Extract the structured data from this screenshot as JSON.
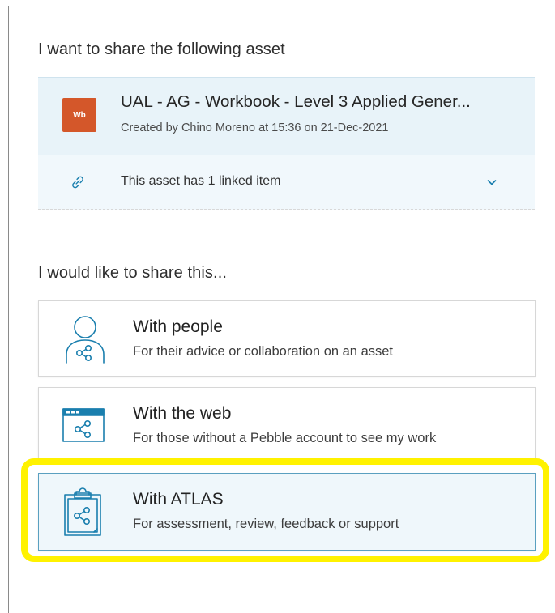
{
  "section1": {
    "heading": "I want to share the following asset"
  },
  "asset": {
    "icon_label": "Wb",
    "icon_color": "#d4572a",
    "title": "UAL - AG - Workbook - Level 3 Applied Gener...",
    "subtitle": "Created by Chino Moreno at 15:36 on 21-Dec-2021",
    "linked_text": "This asset has 1 linked item"
  },
  "section2": {
    "heading": "I would like to share this..."
  },
  "options": [
    {
      "icon": "person-share-icon",
      "title": "With people",
      "desc": "For their advice or collaboration on an asset"
    },
    {
      "icon": "web-share-icon",
      "title": "With the web",
      "desc": "For those without a Pebble account to see my work"
    },
    {
      "icon": "clipboard-share-icon",
      "title": "With ATLAS",
      "desc": "For assessment, review, feedback or support"
    }
  ],
  "colors": {
    "accent": "#1a7fae",
    "highlight": "#fff200",
    "asset_bg": "#e8f3f9"
  }
}
